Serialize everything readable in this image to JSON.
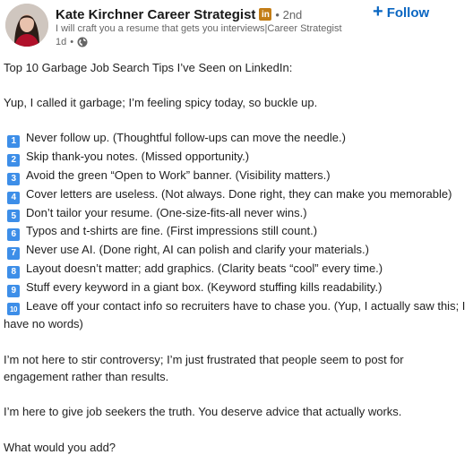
{
  "author": {
    "name": "Kate Kirchner Career Strategist",
    "badge": "in",
    "degree": "• 2nd",
    "headline": "I will craft you a resume that gets you interviews|Career Strategist",
    "time": "1d",
    "dot": "•",
    "visibility_icon": "globe-icon"
  },
  "follow": {
    "label": "Follow"
  },
  "post": {
    "title": "Top 10 Garbage Job Search Tips I’ve Seen on LinkedIn:",
    "intro": "Yup, I called it garbage; I’m feeling spicy today, so buckle up.",
    "tips": [
      {
        "num": "1",
        "text": "Never follow up. (Thoughtful follow-ups can move the needle.)"
      },
      {
        "num": "2",
        "text": "Skip thank-you notes. (Missed opportunity.)"
      },
      {
        "num": "3",
        "text": "Avoid the green “Open to Work” banner. (Visibility matters.)"
      },
      {
        "num": "4",
        "text": "Cover letters are useless. (Not always. Done right, they can make you memorable)"
      },
      {
        "num": "5",
        "text": "Don’t tailor your resume. (One-size-fits-all never wins.)"
      },
      {
        "num": "6",
        "text": "Typos and t-shirts are fine. (First impressions still count.)"
      },
      {
        "num": "7",
        "text": "Never use AI. (Done right, AI can polish and clarify your materials.)"
      },
      {
        "num": "8",
        "text": "Layout doesn’t matter; add graphics. (Clarity beats “cool” every time.)"
      },
      {
        "num": "9",
        "text": "Stuff every keyword in a giant box. (Keyword stuffing kills readability.)"
      },
      {
        "num": "10",
        "text": "Leave off your contact info so recruiters have to chase you. (Yup, I actually saw this; I have no words)"
      }
    ],
    "para1": "I’m not here to stir controversy; I’m just frustrated that people seem to post for engagement rather than results.",
    "para2": "I’m here to give job seekers the truth. You deserve advice that actually works.",
    "question": "What would you add?"
  },
  "colors": {
    "accent": "#0a66c2",
    "badge": "#c37d16",
    "keycap": "#3d8ee8"
  }
}
